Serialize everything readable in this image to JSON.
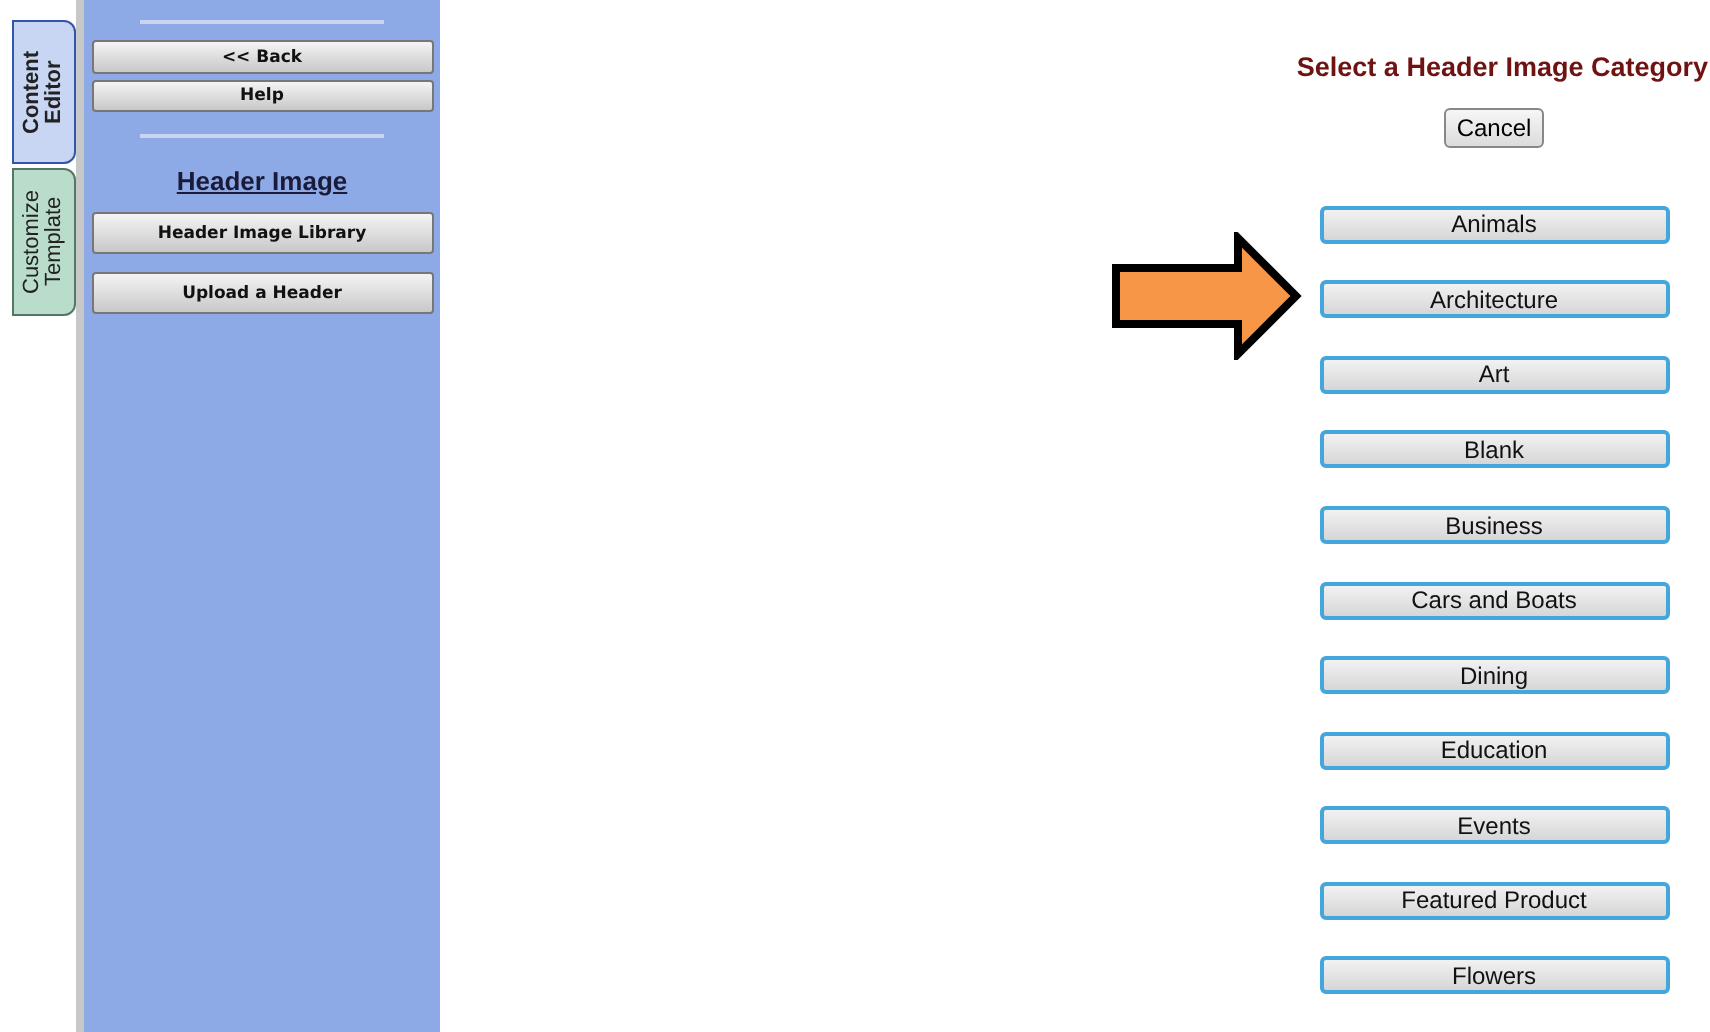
{
  "tabs": [
    {
      "label": "Content Editor",
      "selected": true
    },
    {
      "label": "Customize Template",
      "selected": false
    }
  ],
  "sidebar": {
    "buttons_top": [
      "<< Back",
      "Help"
    ],
    "section_title": "Header Image",
    "buttons": [
      "Header Image Library",
      "Upload a Header"
    ]
  },
  "main": {
    "title": "Select a Header Image Category",
    "cancel": "Cancel",
    "categories": [
      {
        "label": "Animals",
        "pointed": false
      },
      {
        "label": "Architecture",
        "pointed": true
      },
      {
        "label": "Art",
        "pointed": false
      },
      {
        "label": "Blank",
        "pointed": false
      },
      {
        "label": "Business",
        "pointed": false
      },
      {
        "label": "Cars and Boats",
        "pointed": false
      },
      {
        "label": "Dining",
        "pointed": false
      },
      {
        "label": "Education",
        "pointed": false
      },
      {
        "label": "Events",
        "pointed": false
      },
      {
        "label": "Featured Product",
        "pointed": false
      },
      {
        "label": "Flowers",
        "pointed": false
      }
    ]
  }
}
